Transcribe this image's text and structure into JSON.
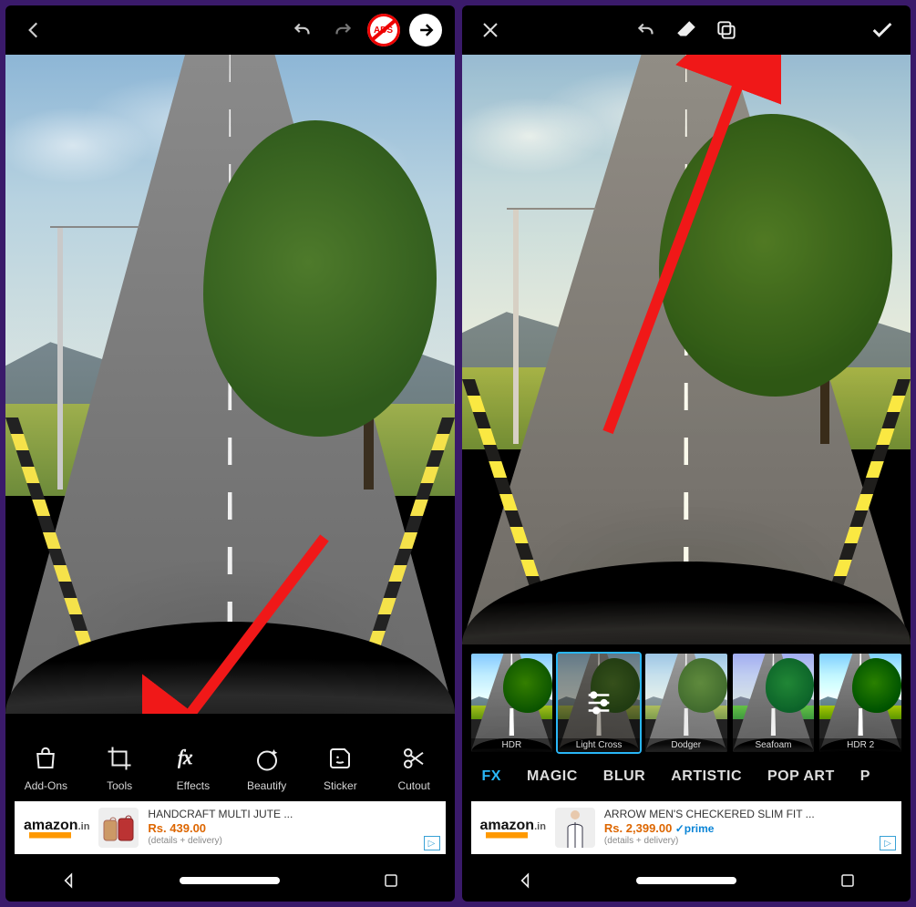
{
  "left": {
    "ads_badge": "ADS",
    "tools": [
      {
        "label": "Add-Ons"
      },
      {
        "label": "Tools"
      },
      {
        "label": "Effects"
      },
      {
        "label": "Beautify"
      },
      {
        "label": "Sticker"
      },
      {
        "label": "Cutout"
      }
    ],
    "ad": {
      "brand": "amazon",
      "brand_suffix": ".in",
      "title": "HANDCRAFT MULTI JUTE ...",
      "price": "Rs. 439.00",
      "sub": "(details + delivery)"
    }
  },
  "right": {
    "thumbs": [
      {
        "label": "HDR"
      },
      {
        "label": "Light Cross",
        "selected": true,
        "has_sliders": true
      },
      {
        "label": "Dodger"
      },
      {
        "label": "Seafoam"
      },
      {
        "label": "HDR 2"
      }
    ],
    "categories": [
      {
        "label": "FX",
        "active": true
      },
      {
        "label": "MAGIC"
      },
      {
        "label": "BLUR"
      },
      {
        "label": "ARTISTIC"
      },
      {
        "label": "POP ART"
      },
      {
        "label": "P"
      }
    ],
    "ad": {
      "brand": "amazon",
      "brand_suffix": ".in",
      "title": "ARROW MEN'S CHECKERED SLIM FIT ...",
      "price": "Rs. 2,399.00",
      "prime": "✓prime",
      "sub": "(details + delivery)"
    }
  }
}
